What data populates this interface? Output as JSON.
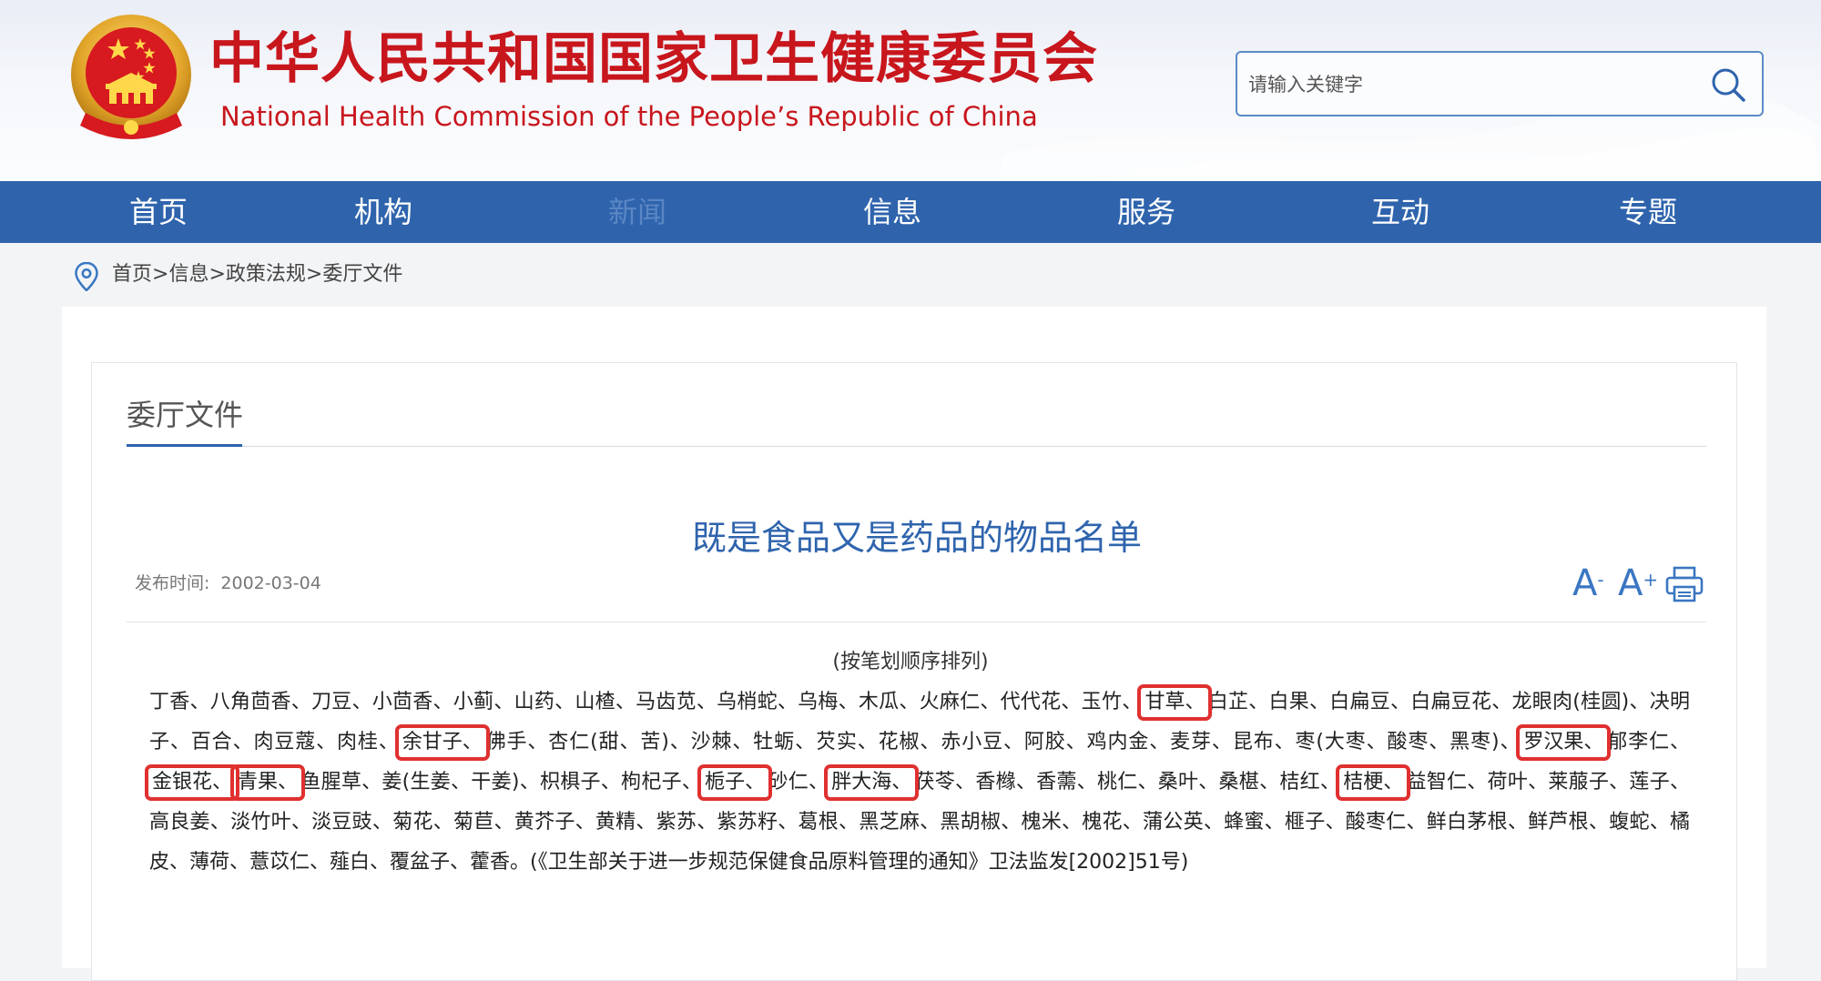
{
  "header": {
    "title_cn": "中华人民共和国国家卫生健康委员会",
    "title_en": "National Health Commission of the People’s Republic of China",
    "emblem_icon": "national-emblem-icon",
    "search": {
      "placeholder": "请输入关键字",
      "icon": "search-icon"
    }
  },
  "nav": {
    "items": [
      "首页",
      "机构",
      "新闻",
      "信息",
      "服务",
      "互动",
      "专题"
    ]
  },
  "breadcrumb": {
    "icon": "location-pin-icon",
    "items": [
      "首页",
      "信息",
      "政策法规",
      "委厅文件"
    ],
    "separator": ">"
  },
  "section": {
    "title": "委厅文件"
  },
  "article": {
    "title": "既是食品又是药品的物品名单",
    "date_label": "发布时间:",
    "date": "2002-03-04",
    "tools": {
      "font_decrease_label": "A",
      "font_decrease_sup": "-",
      "font_increase_label": "A",
      "font_increase_sup": "+",
      "print_icon": "printer-icon"
    },
    "subtitle": "(按笔划顺序排列)",
    "segments": [
      {
        "t": "丁香、八角茴香、刀豆、小茴香、小蓟、山药、山楂、马齿苋、乌梢蛇、乌梅、木瓜、火麻仁、代代花、玉竹、"
      },
      {
        "t": "甘草、",
        "hl": true
      },
      {
        "t": "白芷、白果、白扁豆、白扁豆花、龙眼肉(桂圆)、决明子、百合、肉豆蔻、肉桂、"
      },
      {
        "t": "余甘子、",
        "hl": true
      },
      {
        "t": "佛手、杏仁(甜、苦)、沙棘、牡蛎、芡实、花椒、赤小豆、阿胶、鸡内金、麦芽、昆布、枣(大枣、酸枣、黑枣)、"
      },
      {
        "t": "罗汉果、",
        "hl": true
      },
      {
        "t": "郁李仁、"
      },
      {
        "t": "金银花、",
        "hl": true
      },
      {
        "t": "青果、",
        "hl": true
      },
      {
        "t": "鱼腥草、姜(生姜、干姜)、枳椇子、枸杞子、"
      },
      {
        "t": "栀子、",
        "hl": true
      },
      {
        "t": "砂仁、"
      },
      {
        "t": "胖大海、",
        "hl": true
      },
      {
        "t": "茯苓、香橼、香薷、桃仁、桑叶、桑椹、桔红、"
      },
      {
        "t": "桔梗、",
        "hl": true
      },
      {
        "t": "益智仁、荷叶、莱菔子、莲子、高良姜、淡竹叶、淡豆豉、菊花、菊苣、黄芥子、黄精、紫苏、紫苏籽、葛根、黑芝麻、黑胡椒、槐米、槐花、蒲公英、蜂蜜、榧子、酸枣仁、鲜白茅根、鲜芦根、蝮蛇、橘皮、薄荷、薏苡仁、薤白、覆盆子、藿香。(《卫生部关于进一步规范保健食品原料管理的通知》卫法监发[2002]51号)"
      }
    ]
  },
  "colors": {
    "brand_red": "#c8161d",
    "nav_blue": "#2f64ad",
    "title_blue": "#2f64ad",
    "highlight_red": "#e03030"
  }
}
